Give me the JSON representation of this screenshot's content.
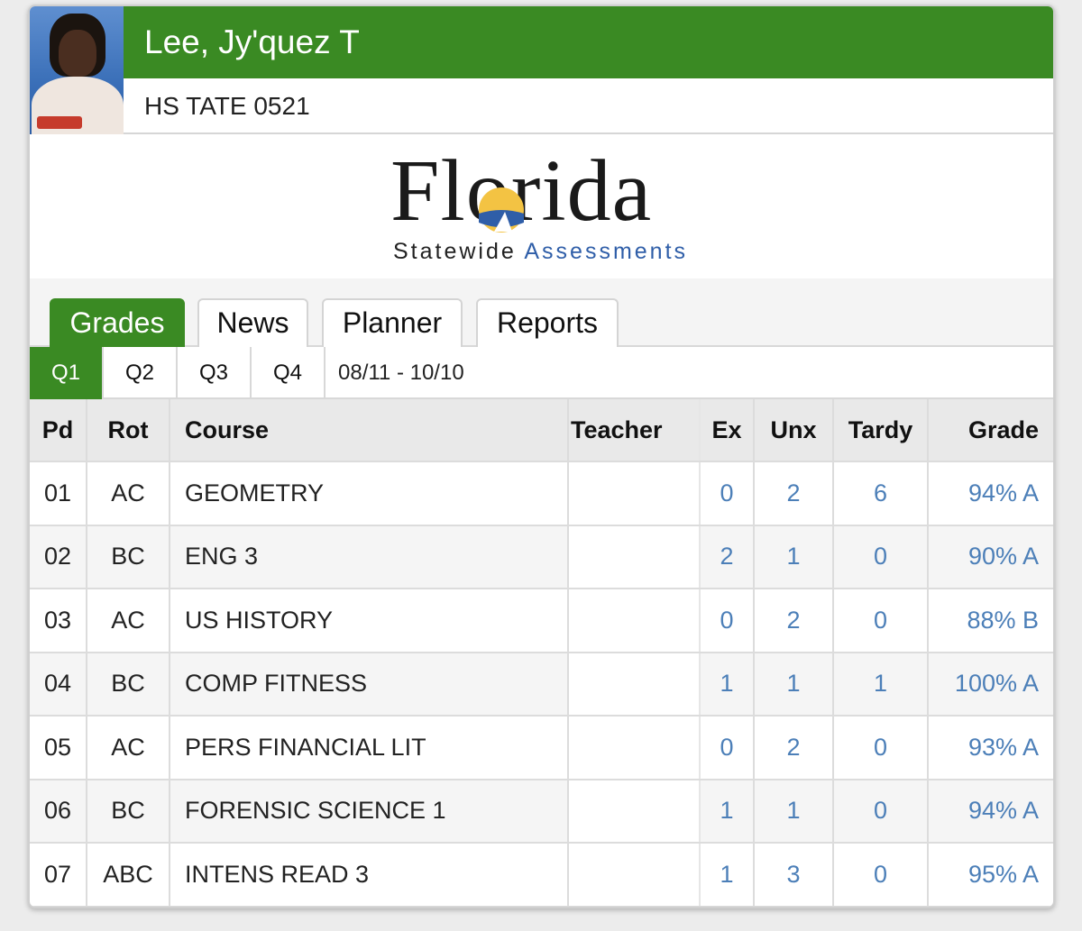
{
  "student": {
    "name": "Lee, Jy'quez T",
    "school": "HS TATE 0521"
  },
  "logo": {
    "word": "Florida",
    "sub_a": "Statewide",
    "sub_b": "Assessments"
  },
  "tabs": [
    {
      "label": "Grades",
      "active": true
    },
    {
      "label": "News",
      "active": false
    },
    {
      "label": "Planner",
      "active": false
    },
    {
      "label": "Reports",
      "active": false
    }
  ],
  "quarters": [
    {
      "label": "Q1",
      "active": true
    },
    {
      "label": "Q2",
      "active": false
    },
    {
      "label": "Q3",
      "active": false
    },
    {
      "label": "Q4",
      "active": false
    }
  ],
  "date_range": "08/11 - 10/10",
  "table": {
    "headers": {
      "pd": "Pd",
      "rot": "Rot",
      "course": "Course",
      "teacher": "Teacher",
      "ex": "Ex",
      "unx": "Unx",
      "tardy": "Tardy",
      "grade": "Grade"
    },
    "rows": [
      {
        "pd": "01",
        "rot": "AC",
        "course": "GEOMETRY",
        "teacher": "",
        "ex": "0",
        "unx": "2",
        "tardy": "6",
        "grade": "94% A"
      },
      {
        "pd": "02",
        "rot": "BC",
        "course": "ENG 3",
        "teacher": "",
        "ex": "2",
        "unx": "1",
        "tardy": "0",
        "grade": "90% A"
      },
      {
        "pd": "03",
        "rot": "AC",
        "course": "US HISTORY",
        "teacher": "",
        "ex": "0",
        "unx": "2",
        "tardy": "0",
        "grade": "88% B"
      },
      {
        "pd": "04",
        "rot": "BC",
        "course": "COMP FITNESS",
        "teacher": "",
        "ex": "1",
        "unx": "1",
        "tardy": "1",
        "grade": "100% A"
      },
      {
        "pd": "05",
        "rot": "AC",
        "course": "PERS FINANCIAL LIT",
        "teacher": "",
        "ex": "0",
        "unx": "2",
        "tardy": "0",
        "grade": "93% A"
      },
      {
        "pd": "06",
        "rot": "BC",
        "course": "FORENSIC SCIENCE 1",
        "teacher": "",
        "ex": "1",
        "unx": "1",
        "tardy": "0",
        "grade": "94% A"
      },
      {
        "pd": "07",
        "rot": "ABC",
        "course": "INTENS READ 3",
        "teacher": "",
        "ex": "1",
        "unx": "3",
        "tardy": "0",
        "grade": "95% A"
      }
    ]
  },
  "colors": {
    "accent_green": "#3a8a23",
    "link_blue": "#4c7fb8"
  }
}
